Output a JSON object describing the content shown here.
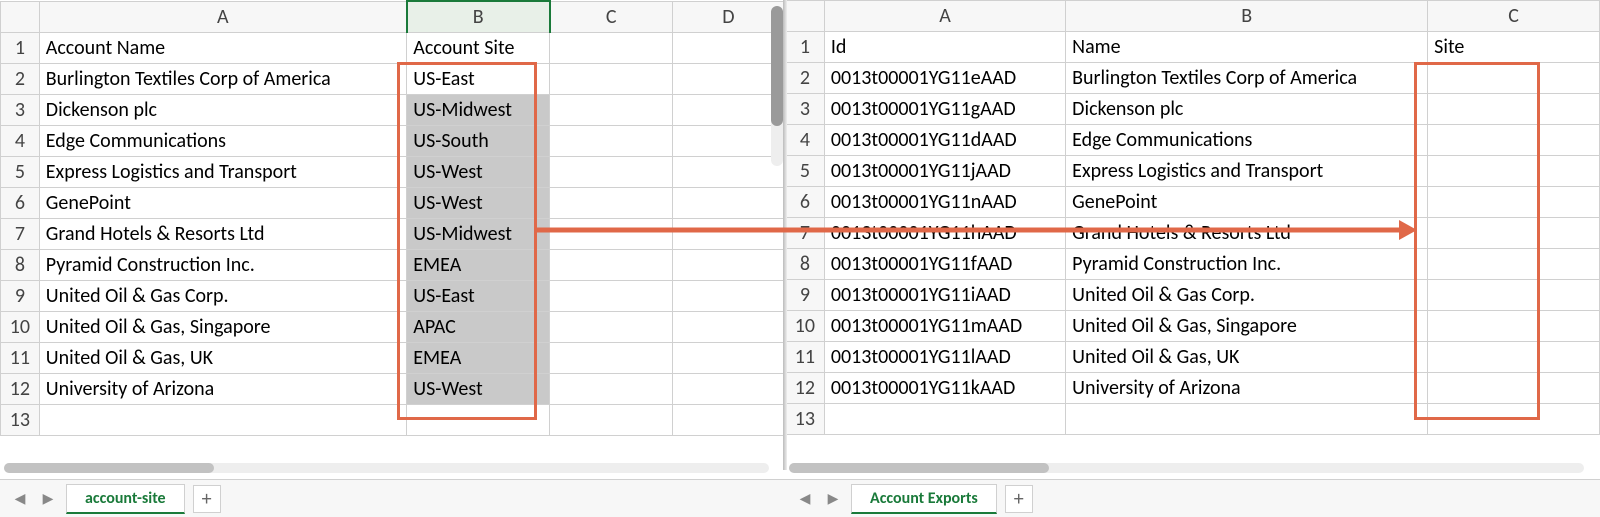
{
  "left": {
    "tab": "account-site",
    "cols": [
      "A",
      "B",
      "C",
      "D"
    ],
    "headers": {
      "A": "Account Name",
      "B": "Account Site"
    },
    "rows": [
      {
        "n": 1
      },
      {
        "n": 2,
        "A": "Burlington Textiles Corp of America",
        "B": "US-East"
      },
      {
        "n": 3,
        "A": "Dickenson plc",
        "B": "US-Midwest"
      },
      {
        "n": 4,
        "A": "Edge Communications",
        "B": "US-South"
      },
      {
        "n": 5,
        "A": "Express Logistics and Transport",
        "B": "US-West"
      },
      {
        "n": 6,
        "A": "GenePoint",
        "B": "US-West"
      },
      {
        "n": 7,
        "A": "Grand Hotels & Resorts Ltd",
        "B": "US-Midwest"
      },
      {
        "n": 8,
        "A": "Pyramid Construction Inc.",
        "B": "EMEA"
      },
      {
        "n": 9,
        "A": "United Oil & Gas Corp.",
        "B": "US-East"
      },
      {
        "n": 10,
        "A": "United Oil & Gas, Singapore",
        "B": "APAC"
      },
      {
        "n": 11,
        "A": "United Oil & Gas, UK",
        "B": "EMEA"
      },
      {
        "n": 12,
        "A": "University of Arizona",
        "B": "US-West"
      },
      {
        "n": 13
      }
    ]
  },
  "right": {
    "tab": "Account Exports",
    "cols": [
      "A",
      "B",
      "C"
    ],
    "headers": {
      "A": "Id",
      "B": "Name",
      "C": "Site"
    },
    "rows": [
      {
        "n": 1
      },
      {
        "n": 2,
        "A": "0013t00001YG11eAAD",
        "B": "Burlington Textiles Corp of America"
      },
      {
        "n": 3,
        "A": "0013t00001YG11gAAD",
        "B": "Dickenson plc"
      },
      {
        "n": 4,
        "A": "0013t00001YG11dAAD",
        "B": "Edge Communications"
      },
      {
        "n": 5,
        "A": "0013t00001YG11jAAD",
        "B": "Express Logistics and Transport"
      },
      {
        "n": 6,
        "A": "0013t00001YG11nAAD",
        "B": "GenePoint"
      },
      {
        "n": 7,
        "A": "0013t00001YG11hAAD",
        "B": "Grand Hotels & Resorts Ltd"
      },
      {
        "n": 8,
        "A": "0013t00001YG11fAAD",
        "B": "Pyramid Construction Inc."
      },
      {
        "n": 9,
        "A": "0013t00001YG11iAAD",
        "B": "United Oil & Gas Corp."
      },
      {
        "n": 10,
        "A": "0013t00001YG11mAAD",
        "B": "United Oil & Gas, Singapore"
      },
      {
        "n": 11,
        "A": "0013t00001YG11lAAD",
        "B": "United Oil & Gas, UK"
      },
      {
        "n": 12,
        "A": "0013t00001YG11kAAD",
        "B": "University of Arizona"
      },
      {
        "n": 13
      }
    ]
  },
  "highlight_color": "#e06848"
}
